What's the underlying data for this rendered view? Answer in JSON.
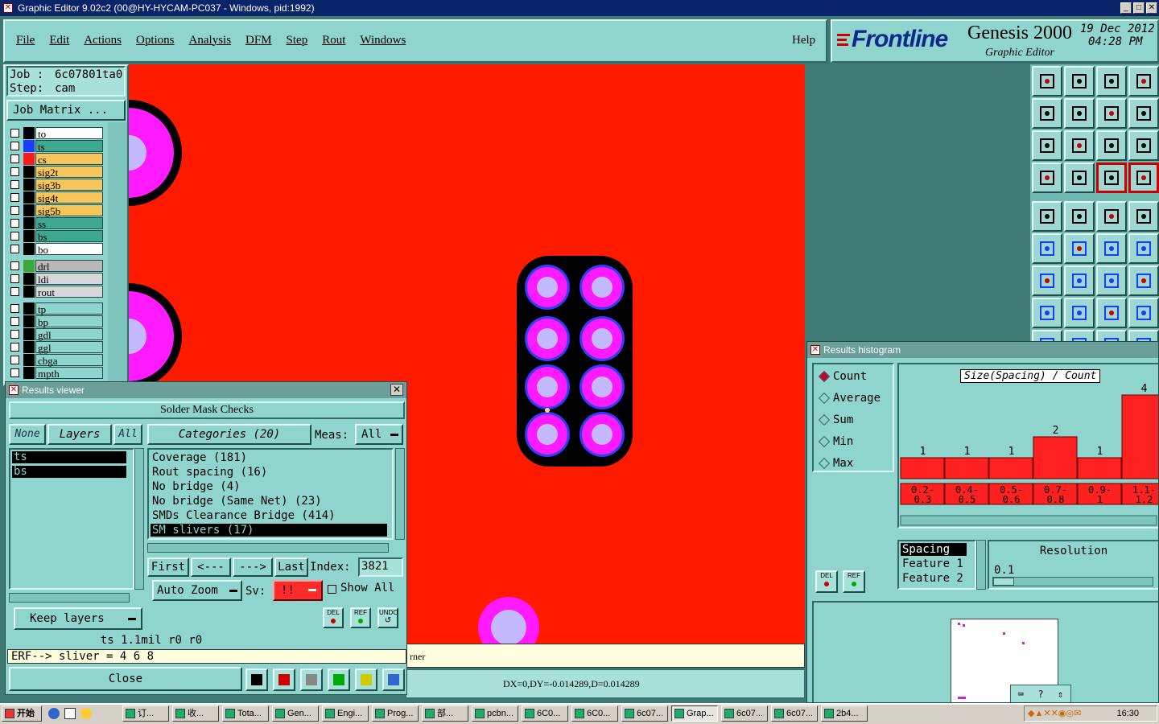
{
  "window": {
    "title": "Graphic Editor 9.02c2 (00@HY-HYCAM-PC037 - Windows, pid:1992)"
  },
  "menu": {
    "items": [
      "File",
      "Edit",
      "Actions",
      "Options",
      "Analysis",
      "DFM",
      "Step",
      "Rout",
      "Windows"
    ],
    "help": "Help"
  },
  "brand": {
    "logo": "Frontline",
    "product": "Genesis 2000",
    "subtitle": "Graphic Editor",
    "date": "19 Dec 2012",
    "time": "04:28 PM"
  },
  "job": {
    "job_label": "Job :",
    "job_value": "6c07801ta0",
    "step_label": "Step:",
    "step_value": "cam",
    "matrix_button": "Job Matrix ..."
  },
  "layers": {
    "group1": [
      {
        "name": "to",
        "color": "#000000",
        "bg": "#ffffff"
      },
      {
        "name": "ts",
        "color": "#1a3cff",
        "bg": "#3fa890"
      },
      {
        "name": "cs",
        "color": "#ff1a1a",
        "bg": "#f6c65c"
      },
      {
        "name": "sig2t",
        "color": "#000000",
        "bg": "#f6c65c"
      },
      {
        "name": "sig3b",
        "color": "#000000",
        "bg": "#f6c65c"
      },
      {
        "name": "sig4t",
        "color": "#000000",
        "bg": "#f6c65c"
      },
      {
        "name": "sig5b",
        "color": "#000000",
        "bg": "#f6c65c"
      },
      {
        "name": "ss",
        "color": "#000000",
        "bg": "#3fa890"
      },
      {
        "name": "bs",
        "color": "#000000",
        "bg": "#3fa890"
      },
      {
        "name": "bo",
        "color": "#000000",
        "bg": "#ffffff"
      }
    ],
    "group2": [
      {
        "name": "drl",
        "color": "#3aa83a",
        "bg": "#b8b8b8"
      },
      {
        "name": "ldi",
        "color": "#000000",
        "bg": "#d8d8d8"
      },
      {
        "name": "rout",
        "color": "#000000",
        "bg": "#d8d8d8"
      }
    ],
    "group3": [
      {
        "name": "tp",
        "color": "#000000",
        "bg": "#8fd4cd"
      },
      {
        "name": "bp",
        "color": "#000000",
        "bg": "#8fd4cd"
      },
      {
        "name": "gdl",
        "color": "#000000",
        "bg": "#8fd4cd"
      },
      {
        "name": "ggl",
        "color": "#000000",
        "bg": "#8fd4cd"
      },
      {
        "name": "cbga",
        "color": "#000000",
        "bg": "#8fd4cd"
      },
      {
        "name": "mpth",
        "color": "#000000",
        "bg": "#8fd4cd"
      }
    ]
  },
  "results_viewer": {
    "title": "Results viewer",
    "heading": "Solder Mask Checks",
    "none_btn": "None",
    "layers_btn": "Layers",
    "all_btn": "All",
    "categories_btn": "Categories (20)",
    "meas_label": "Meas:",
    "meas_value": "All",
    "layer_list": [
      "ts",
      "bs"
    ],
    "categories": [
      "Coverage (181)",
      "Rout spacing (16)",
      "No bridge (4)",
      "No bridge (Same Net) (23)",
      "SMDs Clearance Bridge (414)",
      "SM slivers (17)"
    ],
    "selected_category": 5,
    "first": "First",
    "prev": "<---",
    "next": "--->",
    "last": "Last",
    "index_label": "Index:",
    "index_value": "3821",
    "auto_zoom": "Auto Zoom",
    "sv_label": "Sv:",
    "sv_value": "!!",
    "show_all": "Show All",
    "keep_layers": "Keep layers",
    "del": "DEL",
    "ref": "REF",
    "undo": "UNDO",
    "measure_line": "ts 1.1mil  r0  r0",
    "erf_line": "ERF--> sliver = 4 6 8",
    "close": "Close"
  },
  "histogram": {
    "title": "Results histogram",
    "options": [
      "Count",
      "Average",
      "Sum",
      "Min",
      "Max"
    ],
    "selected_option": 0,
    "chart_title": "Size(Spacing) / Count",
    "del": "DEL",
    "ref": "REF",
    "feature_list": [
      "Spacing",
      "Feature 1",
      "Feature 2"
    ],
    "resolution_label": "Resolution",
    "resolution_value": "0.1"
  },
  "chart_data": {
    "type": "bar",
    "title": "Size(Spacing) / Count",
    "categories": [
      "0.2-0.3",
      "0.4-0.5",
      "0.5-0.6",
      "0.7-0.8",
      "0.9-1",
      "1.1-1.2"
    ],
    "values": [
      1,
      1,
      1,
      2,
      1,
      4
    ],
    "ylim": [
      0,
      4
    ],
    "bar_color": "#ff2020"
  },
  "status": {
    "left_msg": "rner",
    "coords": "DX=0,DY=-0.014289,D=0.014289"
  },
  "taskbar": {
    "start": "开始",
    "items": [
      "订...",
      "收...",
      "Tota...",
      "Gen...",
      "Engi...",
      "Prog...",
      "部...",
      "pcbn...",
      "6C0...",
      "6C0...",
      "6c07...",
      "Grap...",
      "6c07...",
      "6c07...",
      "2b4..."
    ],
    "clock": "16:30"
  },
  "colors": {
    "canvas": "#ff1a00",
    "pad_outer": "#000000",
    "pad_ring": "#ff1aff",
    "pad_inner": "#c4b8ff",
    "ring_blue": "#2a40ff",
    "panel": "#8fd4cd"
  }
}
